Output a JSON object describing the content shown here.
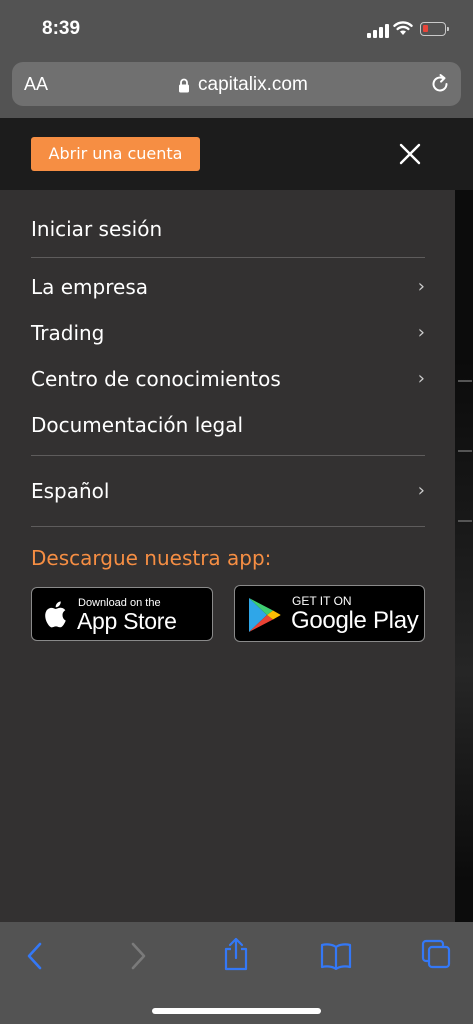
{
  "status": {
    "time": "8:39"
  },
  "browser": {
    "text_size_label": "AA",
    "url": "capitalix.com"
  },
  "header": {
    "open_account_label": "Abrir una cuenta"
  },
  "menu": {
    "login": "Iniciar sesión",
    "items": [
      {
        "label": "La empresa",
        "has_submenu": true
      },
      {
        "label": "Trading",
        "has_submenu": true
      },
      {
        "label": "Centro de conocimientos",
        "has_submenu": true
      },
      {
        "label": "Documentación legal",
        "has_submenu": false
      }
    ],
    "language": "Español",
    "chevron": "›"
  },
  "apps": {
    "title": "Descargue nuestra app:",
    "app_store": {
      "small": "Download on the",
      "big": "App Store"
    },
    "google_play": {
      "small": "GET IT ON",
      "big": "Google Play"
    }
  },
  "colors": {
    "accent": "#f68e43",
    "panel": "#333131",
    "chrome": "#535353",
    "ios_blue": "#3478f6"
  },
  "icons": [
    "signal-icon",
    "wifi-icon",
    "battery-icon",
    "lock-icon",
    "reload-icon",
    "close-icon",
    "chevron-right-icon",
    "apple-logo-icon",
    "google-play-logo-icon",
    "back-icon",
    "forward-icon",
    "share-icon",
    "bookmarks-icon",
    "tabs-icon"
  ]
}
